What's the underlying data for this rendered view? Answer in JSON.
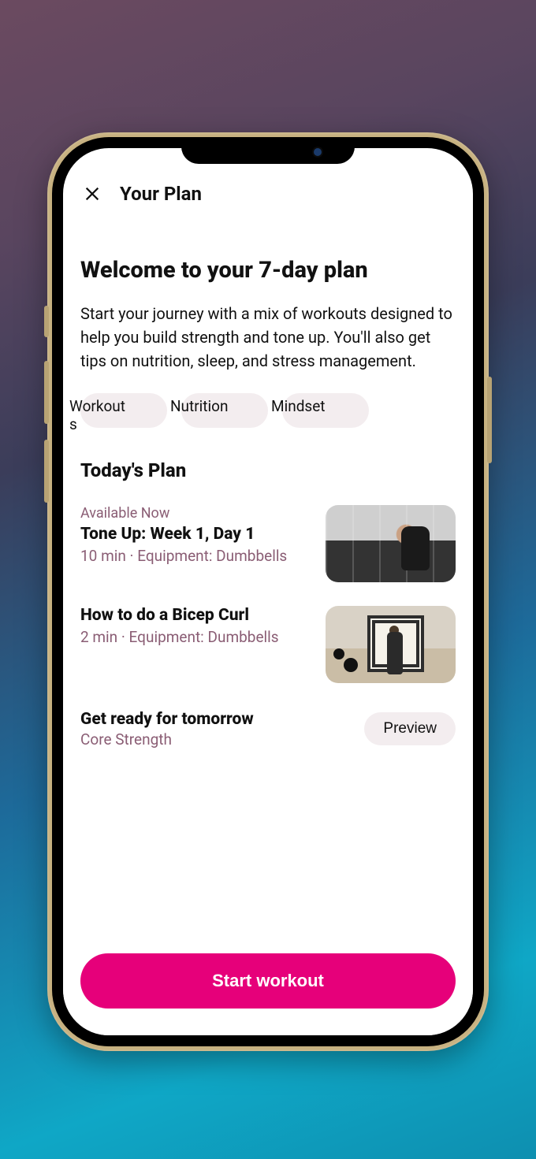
{
  "header": {
    "title": "Your Plan"
  },
  "welcome": {
    "heading": "Welcome to your 7-day plan",
    "body": "Start your journey with a mix of workouts designed to help you build strength and tone up. You'll also get tips on nutrition, sleep, and stress management."
  },
  "chips": [
    {
      "label": "Workouts"
    },
    {
      "label": "Nutrition"
    },
    {
      "label": "Mindset"
    }
  ],
  "today": {
    "heading": "Today's Plan",
    "items": [
      {
        "eyebrow": "Available Now",
        "title": "Tone Up: Week 1, Day 1",
        "meta": "10 min · Equipment: Dumbbells"
      },
      {
        "eyebrow": "",
        "title": "How to do a Bicep Curl",
        "meta": "2 min · Equipment: Dumbbells"
      }
    ]
  },
  "tomorrow": {
    "title": "Get ready for tomorrow",
    "subtitle": "Core Strength",
    "preview_label": "Preview"
  },
  "cta": {
    "label": "Start workout"
  },
  "colors": {
    "accent": "#e6007a",
    "muted": "#8a5d74",
    "chip_bg": "#f3edef"
  }
}
